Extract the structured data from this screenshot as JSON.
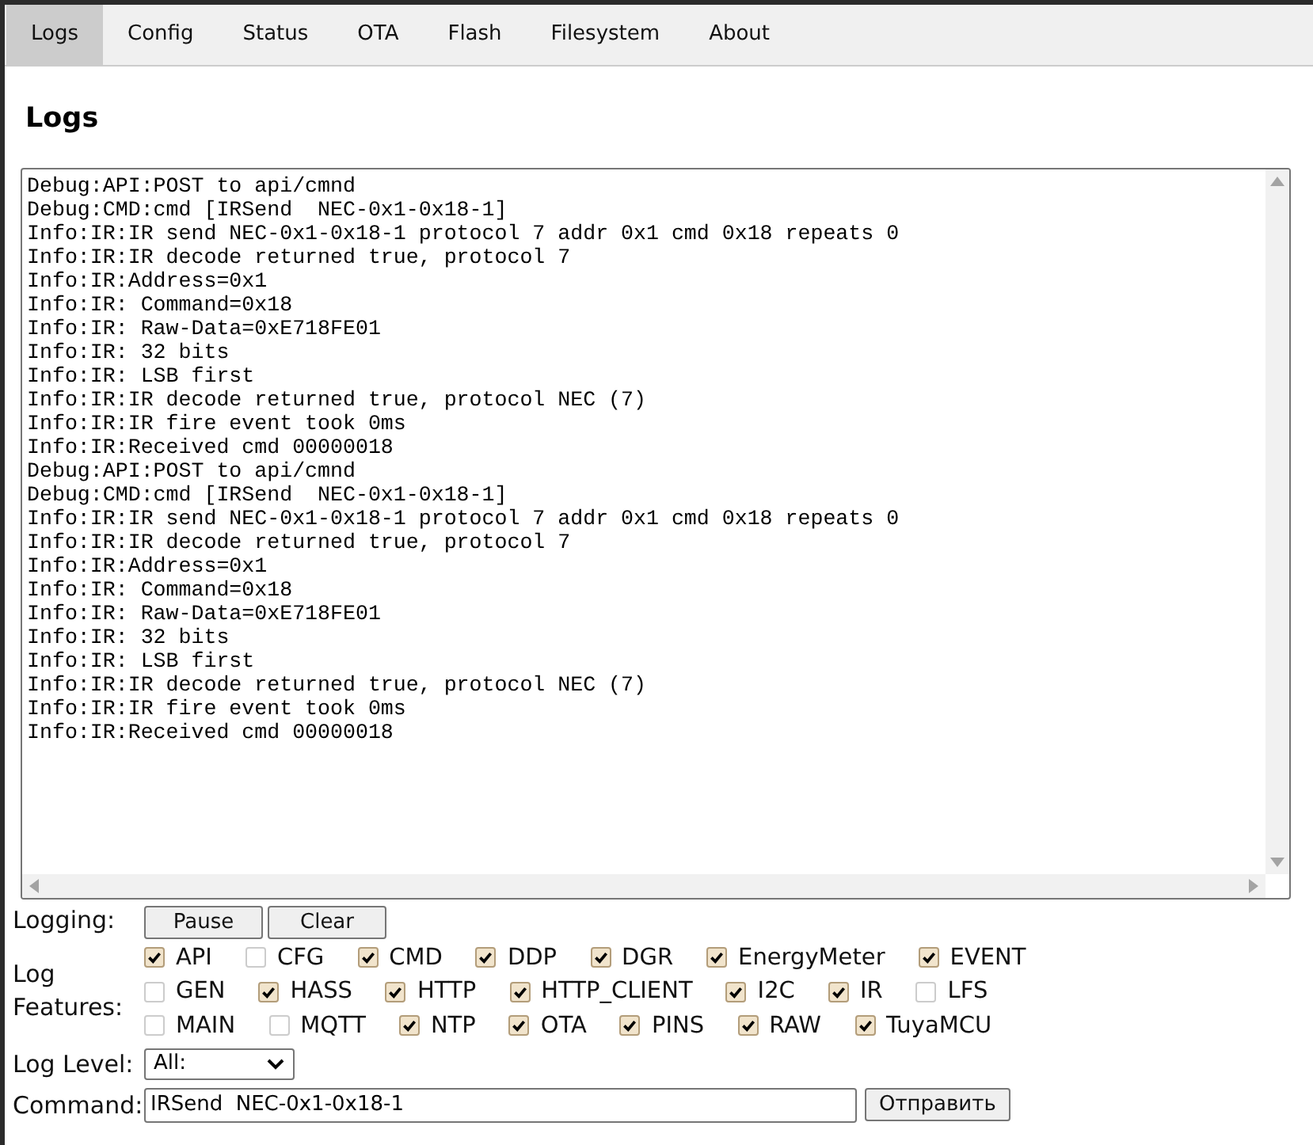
{
  "tabs": [
    {
      "label": "Logs",
      "selected": true
    },
    {
      "label": "Config",
      "selected": false
    },
    {
      "label": "Status",
      "selected": false
    },
    {
      "label": "OTA",
      "selected": false
    },
    {
      "label": "Flash",
      "selected": false
    },
    {
      "label": "Filesystem",
      "selected": false
    },
    {
      "label": "About",
      "selected": false
    }
  ],
  "heading": "Logs",
  "log_lines": [
    "Debug:API:POST to api/cmnd",
    "Debug:CMD:cmd [IRSend  NEC-0x1-0x18-1]",
    "Info:IR:IR send NEC-0x1-0x18-1 protocol 7 addr 0x1 cmd 0x18 repeats 0",
    "Info:IR:IR decode returned true, protocol 7",
    "Info:IR:Address=0x1",
    "Info:IR: Command=0x18",
    "Info:IR: Raw-Data=0xE718FE01",
    "Info:IR: 32 bits",
    "Info:IR: LSB first",
    "Info:IR:IR decode returned true, protocol NEC (7)",
    "Info:IR:IR fire event took 0ms",
    "Info:IR:Received cmd 00000018",
    "Debug:API:POST to api/cmnd",
    "Debug:CMD:cmd [IRSend  NEC-0x1-0x18-1]",
    "Info:IR:IR send NEC-0x1-0x18-1 protocol 7 addr 0x1 cmd 0x18 repeats 0",
    "Info:IR:IR decode returned true, protocol 7",
    "Info:IR:Address=0x1",
    "Info:IR: Command=0x18",
    "Info:IR: Raw-Data=0xE718FE01",
    "Info:IR: 32 bits",
    "Info:IR: LSB first",
    "Info:IR:IR decode returned true, protocol NEC (7)",
    "Info:IR:IR fire event took 0ms",
    "Info:IR:Received cmd 00000018"
  ],
  "logging": {
    "label": "Logging:",
    "buttons": [
      "Pause",
      "Clear"
    ]
  },
  "features": {
    "label": "Log Features:",
    "items": [
      {
        "label": "API",
        "checked": true
      },
      {
        "label": "CFG",
        "checked": false
      },
      {
        "label": "CMD",
        "checked": true
      },
      {
        "label": "DDP",
        "checked": true
      },
      {
        "label": "DGR",
        "checked": true
      },
      {
        "label": "EnergyMeter",
        "checked": true
      },
      {
        "label": "EVENT",
        "checked": true
      },
      {
        "label": "GEN",
        "checked": false
      },
      {
        "label": "HASS",
        "checked": true
      },
      {
        "label": "HTTP",
        "checked": true
      },
      {
        "label": "HTTP_CLIENT",
        "checked": true
      },
      {
        "label": "I2C",
        "checked": true
      },
      {
        "label": "IR",
        "checked": true
      },
      {
        "label": "LFS",
        "checked": false
      },
      {
        "label": "MAIN",
        "checked": false
      },
      {
        "label": "MQTT",
        "checked": false
      },
      {
        "label": "NTP",
        "checked": true
      },
      {
        "label": "OTA",
        "checked": true
      },
      {
        "label": "PINS",
        "checked": true
      },
      {
        "label": "RAW",
        "checked": true
      },
      {
        "label": "TuyaMCU",
        "checked": true
      }
    ]
  },
  "log_level": {
    "label": "Log Level:",
    "value": "All:"
  },
  "command": {
    "label": "Command:",
    "value": "IRSend  NEC-0x1-0x18-1",
    "button": "Отправить"
  }
}
